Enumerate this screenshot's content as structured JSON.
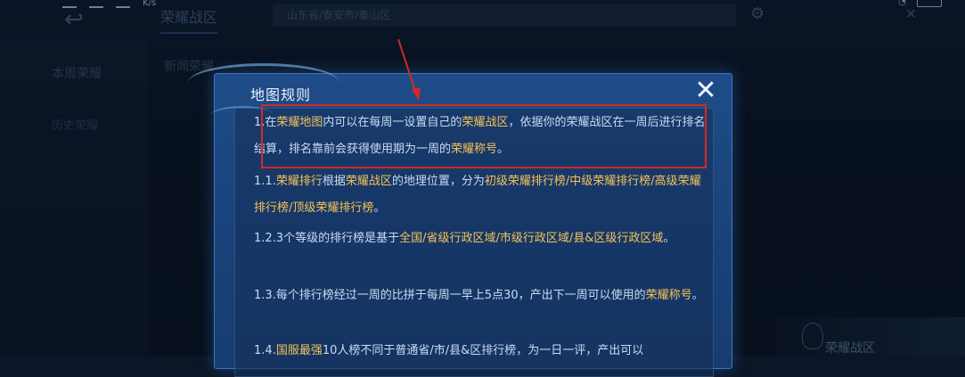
{
  "status_bar": {
    "net_speed": "K/s",
    "icons": [
      "signal-icon",
      "wifi-icon",
      "battery-icon"
    ]
  },
  "background": {
    "tab_active": "荣耀战区",
    "tab_second": "新闻荣耀",
    "search_text": "山东省/泰安市/泰山区",
    "left_item_1": "本周荣耀",
    "left_item_2": "历史荣耀",
    "glory_badge_label": "荣耀战区"
  },
  "modal": {
    "title": "地图规则",
    "close_icon": "close-icon",
    "rules": [
      {
        "id": "1",
        "segments": [
          {
            "t": "1.在",
            "hl": false
          },
          {
            "t": "荣耀地图",
            "hl": true
          },
          {
            "t": "内可以在每周一设置自己的",
            "hl": false
          },
          {
            "t": "荣耀战区",
            "hl": true
          },
          {
            "t": "，依据你的荣耀战区在一周后进行排名结算，排名靠前会获得使用期为一周的",
            "hl": false
          },
          {
            "t": "荣耀称号",
            "hl": true
          },
          {
            "t": "。",
            "hl": false
          }
        ]
      },
      {
        "id": "1.1",
        "segments": [
          {
            "t": "1.1.",
            "hl": false
          },
          {
            "t": "荣耀排行",
            "hl": true
          },
          {
            "t": "根据",
            "hl": false
          },
          {
            "t": "荣耀战区",
            "hl": true
          },
          {
            "t": "的地理位置，分为",
            "hl": false
          },
          {
            "t": "初级荣耀排行榜/中级荣耀排行榜/高级荣耀排行榜/顶级荣耀排行榜",
            "hl": true
          },
          {
            "t": "。",
            "hl": false
          }
        ]
      },
      {
        "id": "1.2",
        "segments": [
          {
            "t": "1.2.3个等级的排行榜是基于",
            "hl": false
          },
          {
            "t": "全国/省级行政区域/市级行政区域/县&区级行政区域",
            "hl": true
          },
          {
            "t": "。",
            "hl": false
          }
        ]
      },
      {
        "id": "1.3",
        "segments": [
          {
            "t": "1.3.每个排行榜经过一周的比拼于每周一早上5点30，产出下一周可以使用的",
            "hl": false
          },
          {
            "t": "荣耀称号",
            "hl": true
          },
          {
            "t": "。",
            "hl": false
          }
        ]
      },
      {
        "id": "1.4",
        "segments": [
          {
            "t": "1.4.",
            "hl": false
          },
          {
            "t": "国服最强",
            "hl": true
          },
          {
            "t": "10人榜不同于普通省/市/县&区排行榜，为一日一评，产出可以",
            "hl": false
          }
        ]
      }
    ]
  },
  "colors": {
    "highlight": "#f4c35a",
    "annotation": "#d22a24",
    "modal_bg": "#1f4c88"
  }
}
